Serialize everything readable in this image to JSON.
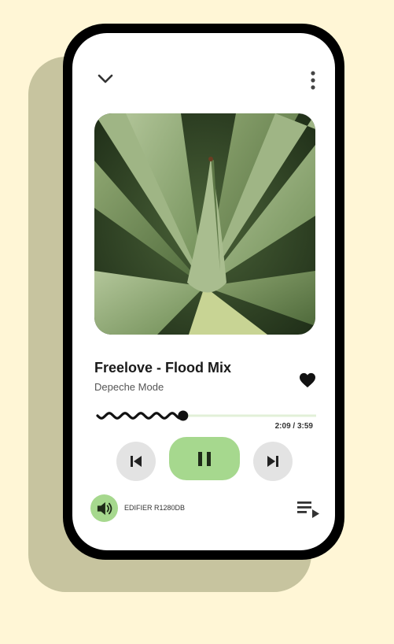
{
  "track": {
    "title": "Freelove - Flood Mix",
    "artist": "Depeche Mode",
    "liked": true
  },
  "playback": {
    "time_readout": "2:09 / 3:59",
    "progress_fraction": 0.4,
    "state": "playing"
  },
  "output": {
    "device_name": "EDIFIER R1280DB"
  },
  "icons": {
    "collapse": "chevron-down-icon",
    "menu": "more-vertical-icon",
    "like": "heart-icon",
    "previous": "skip-previous-icon",
    "pause": "pause-icon",
    "next": "skip-next-icon",
    "speaker": "volume-icon",
    "queue": "queue-music-icon"
  },
  "colors": {
    "background": "#fff6d6",
    "shadow": "#c7c49f",
    "accent": "#a6d88e",
    "track_remaining": "#e2f0d8",
    "secondary_button": "#e3e3e3"
  }
}
